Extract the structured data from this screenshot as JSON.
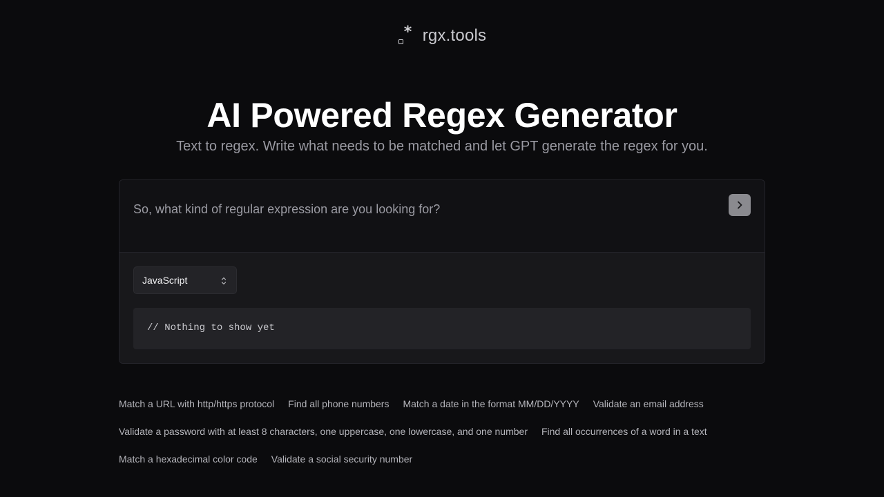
{
  "header": {
    "brand": "rgx.tools",
    "logo_icon": "regex-star-icon"
  },
  "hero": {
    "title": "AI Powered Regex Generator",
    "subtitle": "Text to regex. Write what needs to be matched and let GPT generate the regex for you."
  },
  "prompt": {
    "placeholder": "So, what kind of regular expression are you looking for?",
    "value": "",
    "submit_icon": "chevron-right-icon"
  },
  "language_select": {
    "selected": "JavaScript",
    "icon": "chevron-up-down-icon"
  },
  "output": {
    "text": "// Nothing to show yet"
  },
  "suggestions": [
    "Match a URL with http/https protocol",
    "Find all phone numbers",
    "Match a date in the format MM/DD/YYYY",
    "Validate an email address",
    "Validate a password with at least 8 characters, one uppercase, one lowercase, and one number",
    "Find all occurrences of a word in a text",
    "Match a hexadecimal color code",
    "Validate a social security number"
  ],
  "colors": {
    "background": "#0b0b0d",
    "card": "#121215",
    "button": "#8a8a8f"
  }
}
